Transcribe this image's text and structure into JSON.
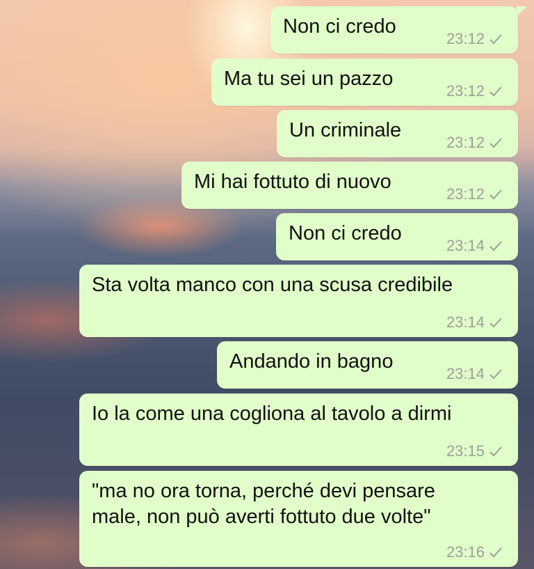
{
  "messages": [
    {
      "text": "Non ci credo",
      "time": "23:12"
    },
    {
      "text": "Ma tu sei un pazzo",
      "time": "23:12"
    },
    {
      "text": "Un criminale",
      "time": "23:12"
    },
    {
      "text": "Mi hai fottuto di nuovo",
      "time": "23:12"
    },
    {
      "text": "Non ci credo",
      "time": "23:14"
    },
    {
      "text": "Sta volta manco con una scusa credibile",
      "time": "23:14"
    },
    {
      "text": "Andando in bagno",
      "time": "23:14"
    },
    {
      "text": "Io la come una cogliona al tavolo a dirmi",
      "time": "23:15"
    },
    {
      "text_lines": [
        "\"ma no ora torna, perché devi pensare",
        "male, non può averti fottuto due volte\""
      ],
      "time": "23:16"
    }
  ],
  "icons": {
    "sent_status": "check-icon"
  },
  "colors": {
    "bubble": "#e1fdc9",
    "meta": "#9aa09a"
  }
}
